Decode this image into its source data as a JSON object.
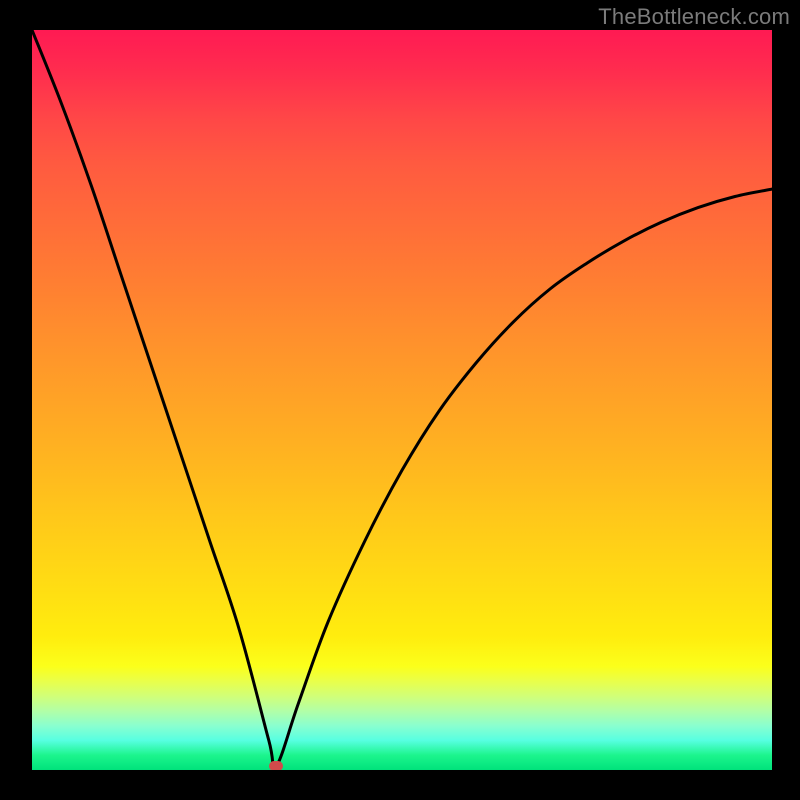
{
  "watermark": "TheBottleneck.com",
  "chart_data": {
    "type": "line",
    "title": "",
    "xlabel": "",
    "ylabel": "",
    "xlim": [
      0,
      100
    ],
    "ylim": [
      0,
      100
    ],
    "marker": {
      "x": 33,
      "y": 0.5
    },
    "series": [
      {
        "name": "curve",
        "x": [
          0,
          4,
          8,
          12,
          16,
          20,
          24,
          28,
          32,
          33,
          36,
          40,
          45,
          50,
          55,
          60,
          65,
          70,
          75,
          80,
          85,
          90,
          95,
          100
        ],
        "y": [
          100,
          90,
          79,
          67,
          55,
          43,
          31,
          19,
          4,
          0.5,
          9,
          20,
          31,
          40.5,
          48.5,
          55,
          60.5,
          65,
          68.5,
          71.5,
          74,
          76,
          77.5,
          78.5
        ]
      }
    ],
    "background_gradient": {
      "top": "#ff1a53",
      "mid": "#ffda14",
      "bottom": "#00e27b"
    }
  }
}
